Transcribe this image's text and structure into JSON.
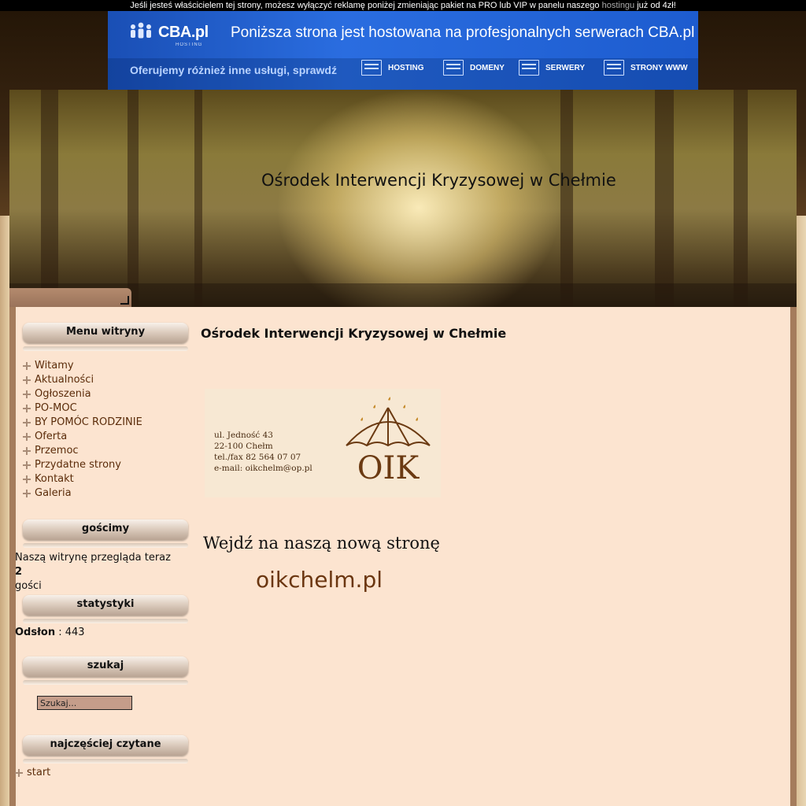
{
  "notice": {
    "text_before": "Jeśli jesteś właścicielem tej strony, możesz wyłączyć reklamę poniżej zmieniając pakiet na PRO lub VIP w panelu naszego ",
    "link": "hostingu",
    "text_after": " już od 4zł!"
  },
  "ad": {
    "logo": "CBA.pl",
    "logo_sub": "HOSTING",
    "headline": "Poniższa strona jest hostowana na profesjonalnych serwerach CBA.pl",
    "offer": "Oferujemy różnież inne usługi, sprawdź",
    "links": [
      "HOSTING",
      "DOMENY",
      "SERWERY",
      "STRONY WWW"
    ],
    "icons": [
      "server-icon",
      "domain-icon",
      "servers-icon",
      "www-icon"
    ]
  },
  "header": {
    "site_title": "Ośrodek Interwencji Kryzysowej w Chełmie"
  },
  "sidebar": {
    "menu_title": "Menu witryny",
    "menu_items": [
      "Witamy",
      "Aktualności",
      "Ogłoszenia",
      "PO-MOC",
      "BY POMÓC RODZINIE",
      "Oferta",
      "Przemoc",
      "Przydatne strony",
      "Kontakt",
      "Galeria"
    ],
    "guests_title": "gościmy",
    "guests_text_before": "Naszą witrynę przegląda teraz ",
    "guests_count": "2",
    "guests_text_after": " gości",
    "stats_title": "statystyki",
    "stats_label": "Odsłon",
    "stats_sep": " : ",
    "stats_value": "443",
    "search_title": "szukaj",
    "search_placeholder": "Szukaj...",
    "popular_title": "najczęściej czytane",
    "popular_items": [
      "start"
    ]
  },
  "content": {
    "title": "Ośrodek Interwencji Kryzysowej w Chełmie",
    "card": {
      "address_lines": [
        "ul. Jedność 43",
        "22-100 Chełm",
        "tel./fax 82 564 07 07",
        "e-mail: oikchelm@op.pl"
      ],
      "logo_text": "OIK"
    },
    "new_site_text": "Wejdź na naszą nową stronę",
    "new_site_url": "oikchelm.pl"
  },
  "colors": {
    "content_bg": "#fce4d0",
    "menu_link": "#5b2c0a",
    "ad_blue": "#1d5ccf"
  }
}
